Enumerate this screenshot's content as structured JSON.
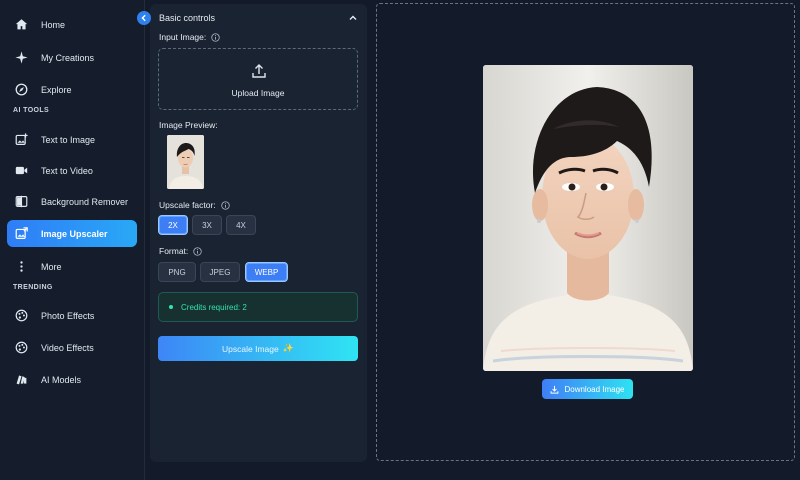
{
  "sidebar": {
    "items": [
      {
        "label": "Home",
        "icon": "home-icon"
      },
      {
        "label": "My Creations",
        "icon": "sparkle-icon"
      },
      {
        "label": "Explore",
        "icon": "compass-icon"
      }
    ],
    "ai_tools_heading": "AI TOOLS",
    "ai_tools": [
      {
        "label": "Text to Image",
        "icon": "image-plus-icon"
      },
      {
        "label": "Text to Video",
        "icon": "video-icon"
      },
      {
        "label": "Background Remover",
        "icon": "split-image-icon"
      },
      {
        "label": "Image Upscaler",
        "icon": "upscale-icon",
        "active": true
      },
      {
        "label": "More",
        "icon": "more-vertical-icon"
      }
    ],
    "trending_heading": "TRENDING",
    "trending": [
      {
        "label": "Photo Effects",
        "icon": "palette-icon"
      },
      {
        "label": "Video Effects",
        "icon": "palette-icon"
      },
      {
        "label": "AI Models",
        "icon": "models-icon"
      }
    ]
  },
  "panel": {
    "title": "Basic controls",
    "input_label": "Input Image:",
    "upload_label": "Upload Image",
    "preview_label": "Image Preview:",
    "upscale_label": "Upscale factor:",
    "upscale_options": [
      "2X",
      "3X",
      "4X"
    ],
    "upscale_selected": "2X",
    "format_label": "Format:",
    "format_options": [
      "PNG",
      "JPEG",
      "WEBP"
    ],
    "format_selected": "WEBP",
    "credits_text": "Credits required: 2",
    "primary_button": "Upscale Image"
  },
  "preview": {
    "download_button": "Download Image"
  },
  "colors": {
    "accent": "#2f7df6",
    "accent_end": "#2fe4f3",
    "credits": "#38e0b0",
    "background": "#131b2b"
  }
}
